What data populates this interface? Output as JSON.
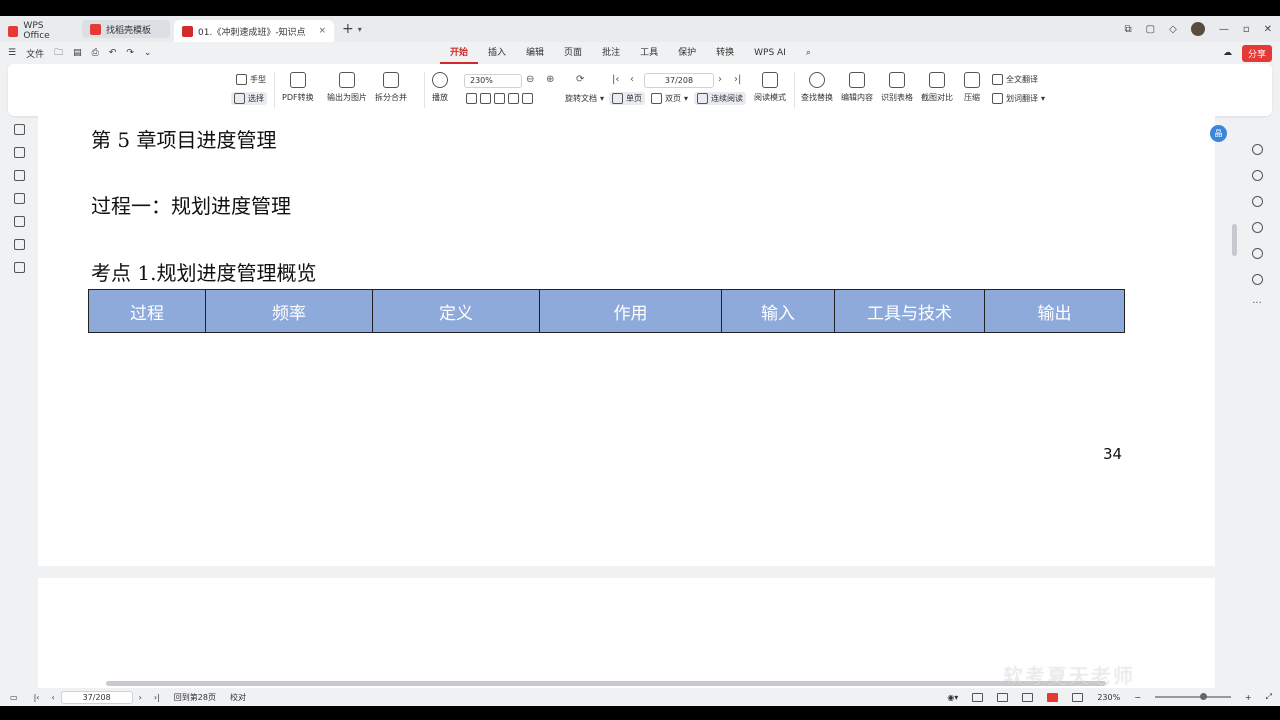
{
  "titlebar": {
    "tab_home": "WPS Office",
    "tab_template": "找稻壳模板",
    "tab_doc": "01.《冲刺速成班》-知识点",
    "tab_doc_close": "×",
    "plus": "+"
  },
  "menubar": {
    "file": "文件",
    "tabs": [
      "开始",
      "插入",
      "编辑",
      "页面",
      "批注",
      "工具",
      "保护",
      "转换",
      "WPS AI"
    ],
    "active_tab": "开始",
    "share": "分享"
  },
  "ribbon": {
    "hand": "手型",
    "select": "选择",
    "pdf_convert": "PDF转换",
    "export_image": "输出为图片",
    "split_merge": "拆分合并",
    "play": "播放",
    "zoom": "230%",
    "rotate": "旋转文档",
    "page_nav": "37/208",
    "single": "单页",
    "double": "双页",
    "continuous": "连续阅读",
    "read_mode": "阅读模式",
    "find_replace": "查找替换",
    "edit_content": "编辑内容",
    "recognize_table": "识别表格",
    "screenshot_compare": "截图对比",
    "compress": "压缩",
    "full_translate": "全文翻译",
    "word_translate": "划词翻译"
  },
  "document": {
    "heading_chapter": "第 5 章项目进度管理",
    "heading_process": "过程一：规划进度管理",
    "heading_point": "考点 1.规划进度管理概览",
    "table_headers": [
      "过程",
      "频率",
      "定义",
      "作用",
      "输入",
      "工具与技术",
      "输出"
    ],
    "page_number": "34",
    "header_color": "#8eaadb"
  },
  "statusbar": {
    "page_input": "37/208",
    "goto_page": "回到第28页",
    "proofread": "校对",
    "zoom": "230%"
  },
  "watermark": "软考夏天老师"
}
